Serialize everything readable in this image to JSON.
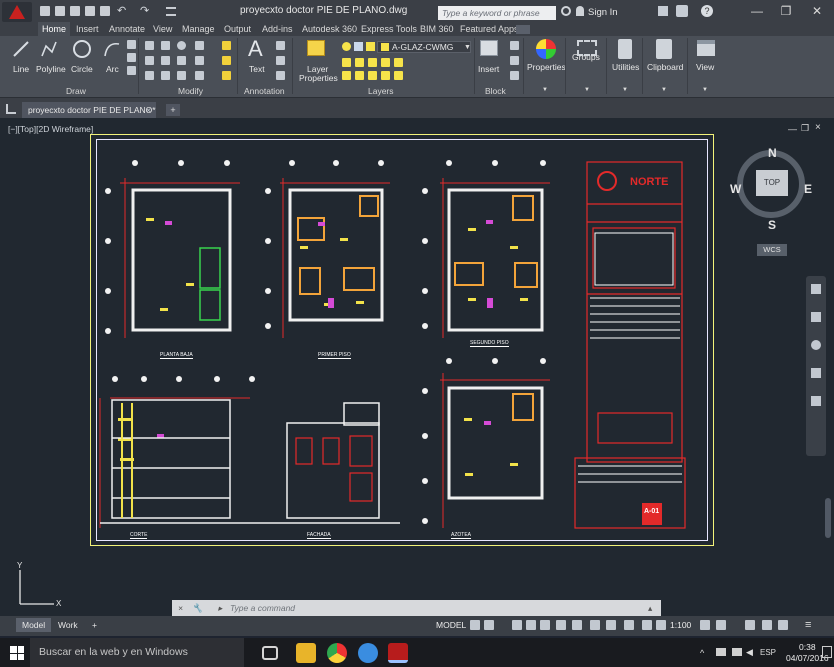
{
  "window": {
    "title": "proyecxto doctor  PIE DE PLANO.dwg",
    "search_placeholder": "Type a keyword or phrase",
    "sign_in": "Sign In",
    "controls": [
      "—",
      "❐",
      "✕"
    ]
  },
  "ribbon": {
    "tabs": [
      "Home",
      "Insert",
      "Annotate",
      "View",
      "Manage",
      "Output",
      "Add-ins",
      "Autodesk 360",
      "Express Tools",
      "BIM 360",
      "Featured Apps"
    ],
    "active_tab": "Home",
    "draw_tools": [
      "Line",
      "Polyline",
      "Circle",
      "Arc"
    ],
    "text_tool": "Text",
    "layer_properties": [
      "Layer",
      "Properties"
    ],
    "current_layer": "A-GLAZ-CWMG",
    "insert_tool": "Insert",
    "big_tools": [
      "Properties",
      "Groups",
      "Utilities",
      "Clipboard",
      "View"
    ],
    "panels": [
      "Draw",
      "Modify",
      "Annotation",
      "Layers",
      "Block"
    ]
  },
  "document_tab": {
    "label": "proyecxto doctor  PIE DE PLANO*",
    "add": "+"
  },
  "canvas": {
    "viewport_label": "[−][Top][2D Wireframe]",
    "viewcube": {
      "top": "TOP",
      "north": "N",
      "south": "S",
      "east": "E",
      "west": "W",
      "wcs": "WCS"
    },
    "drawing_labels": [
      "PLANTA BAJA",
      "PRIMER PISO",
      "SEGUNDO PISO",
      "CORTE",
      "FACHADA",
      "AZOTEA"
    ],
    "title_block": {
      "logo_text": "NORTE",
      "sheet_id": "A-01"
    }
  },
  "command_line": {
    "placeholder": "Type  a  command"
  },
  "status_bar": {
    "layout_tabs": [
      "Model",
      "Work"
    ],
    "active_layout": "Model",
    "add": "+",
    "mode": "MODEL",
    "scale": "1:100"
  },
  "taskbar": {
    "search": "Buscar en la web y en Windows",
    "language": "ESP",
    "time": "0:38",
    "date": "04/07/2016"
  },
  "colors": {
    "title_bar": "#3b3f46",
    "ribbon": "#4a4f57",
    "canvas": "#212830",
    "sheet_border": "#f3f37a",
    "drawing_red": "#e32a2a",
    "drawing_yellow": "#f2e24a",
    "drawing_orange": "#f3a43a",
    "drawing_magenta": "#d54bd6"
  }
}
